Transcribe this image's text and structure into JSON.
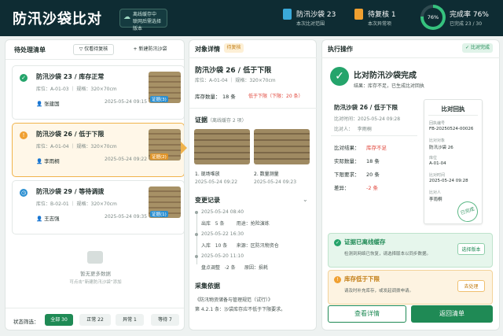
{
  "header": {
    "title": "防汛沙袋比对",
    "offline_line1": "离线缓存中",
    "offline_line2": "联网后需选择版本",
    "stat1_main": "防汛沙袋 23",
    "stat1_sub": "本次比对范围",
    "stat2_main": "待复核 1",
    "stat2_sub": "本次异常项",
    "ring_value": "76%",
    "ring_fraction": 0.76,
    "stat3_main": "完成率 76%",
    "stat3_sub": "已完成 23 / 30"
  },
  "left": {
    "title": "待处理清单",
    "filter_btn": "仅看待复核",
    "new_btn": "+ 新建防汛沙袋",
    "cards": [
      {
        "title": "防汛沙袋 23 / 库存正常",
        "meta": "库位：A-01-03 ｜ 规格：320×70cm",
        "user": "张建国",
        "time": "2025-05-24 09:15",
        "tag": "证据(3)"
      },
      {
        "title": "防汛沙袋 26 / 低于下限",
        "meta": "库位：A-01-04 ｜ 规格：320×70cm",
        "user": "李雨桐",
        "time": "2025-05-24 09:22",
        "tag": "证据(2)"
      },
      {
        "title": "防汛沙袋 29 / 等待调拨",
        "meta": "库位：B-02-01 ｜ 规格：320×70cm",
        "user": "王志强",
        "time": "2025-05-24 09:35",
        "tag": "证据(1)"
      }
    ],
    "empty_title": "暂无更多数据",
    "empty_hint": "可点击“新建防汛沙袋”添加",
    "filter_label": "状态筛选：",
    "chips": [
      {
        "label": "全部",
        "count": "30"
      },
      {
        "label": "正常",
        "count": "22"
      },
      {
        "label": "异常",
        "count": "1"
      },
      {
        "label": "等待",
        "count": "7"
      }
    ]
  },
  "mid": {
    "title": "对象详情",
    "badge": "待复核",
    "obj_title": "防汛沙袋 26 / 低于下限",
    "obj_meta": "库位：A-01-04 ｜ 规格：320×70cm",
    "stock_label": "库存数量：",
    "stock_value": "18 条",
    "stock_warn": "低于下限（下限：20 条）",
    "evidence_title": "证据",
    "evidence_sub": "（离线缓存 2 项）",
    "photos": [
      {
        "caption": "1. 现场堆放",
        "time": "2025-05-24 09:22"
      },
      {
        "caption": "2. 数量测量",
        "time": "2025-05-24 09:23"
      }
    ],
    "changes_title": "变更记录",
    "changes": [
      {
        "time": "2025-05-24 08:40",
        "line": "出库   5 条        用途：抢险演练"
      },
      {
        "time": "2025-05-22 16:30",
        "line": "入库   10 条      来源：区防汛物资仓"
      },
      {
        "time": "2025-05-20 11:10",
        "line": "盘点调整   -2 条      原因：损耗"
      }
    ],
    "basis_title": "采集依据",
    "basis_line1": "《防汛物资储备与管理规范（试行）》",
    "basis_line2": "第 4.2.1 条：沙袋库存应不低于下限要求。"
  },
  "right": {
    "title": "执行操作",
    "badge": "比对完成",
    "done_title": "比对防汛沙袋完成",
    "done_sub": "结果：库存不足，已生成比对回执",
    "record_title": "防汛沙袋 26 / 低于下限",
    "record_time": "比对时间：2025-05-24 09:28",
    "record_user": "比对人：   李雨桐",
    "rows": [
      {
        "k": "比对结果：",
        "v": "库存不足"
      },
      {
        "k": "实际数量：",
        "v": "18 条"
      },
      {
        "k": "下限要求：",
        "v": "20 条"
      },
      {
        "k": "差异：",
        "v": "-2 条"
      }
    ],
    "receipt_title": "比对回执",
    "receipt": [
      {
        "k": "回执编号",
        "v": "FB-20250524-00026"
      },
      {
        "k": "比对对象",
        "v": "防汛沙袋 26"
      },
      {
        "k": "库位",
        "v": "A-01-04"
      },
      {
        "k": "比对时间",
        "v": "2025-05-24 09:28"
      },
      {
        "k": "比对人",
        "v": "李雨桐"
      }
    ],
    "stamp": "已完成",
    "alert1_title": "证据已离线缓存",
    "alert1_desc": "检测到网络已恢复，请选择版本以同步数据。",
    "alert1_btn": "选择版本",
    "alert2_title": "库存低于下限",
    "alert2_desc": "请及时补充库存，或发起调拨申请。",
    "alert2_btn": "去处理",
    "btn_detail": "查看详情",
    "btn_back": "返回清单"
  }
}
